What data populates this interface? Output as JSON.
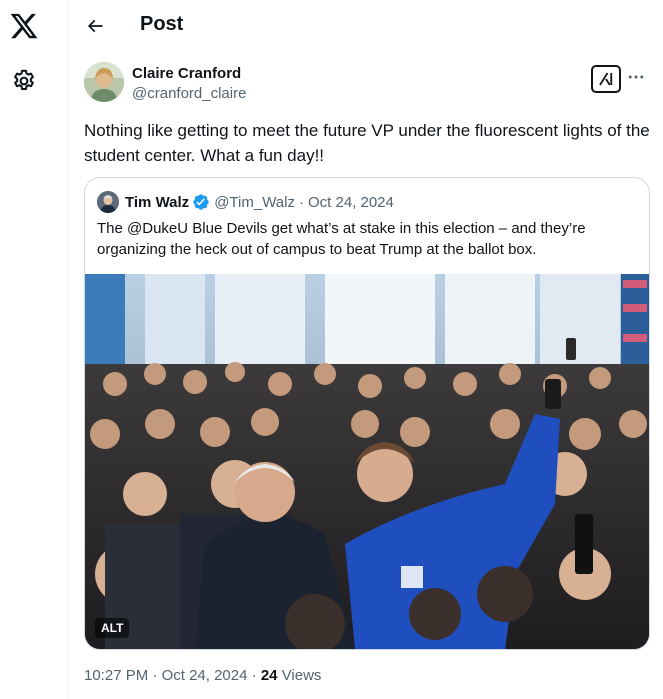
{
  "nav": {
    "logo_icon": "x-logo-icon",
    "settings_icon": "gear-icon"
  },
  "header": {
    "back_icon": "arrow-left-icon",
    "title": "Post"
  },
  "post": {
    "author_name": "Claire Cranford",
    "author_handle": "@cranford_claire",
    "text": "Nothing like getting to meet the future VP under the fluorescent lights of the student center. What a fun day!!",
    "time": "10:27 PM",
    "date": "Oct 24, 2024",
    "separator": "·",
    "views_count": "24",
    "views_label": "Views"
  },
  "quote": {
    "author_name": "Tim Walz",
    "author_handle": "@Tim_Walz",
    "separator": "·",
    "date": "Oct 24, 2024",
    "verified": true,
    "text": "The @DukeU Blue Devils get what’s at stake in this election – and they’re organizing the heck out of campus to beat Trump at the ballot box.",
    "image_alt_badge": "ALT"
  },
  "colors": {
    "text_primary": "#0f1419",
    "text_secondary": "#536471",
    "border": "#cfd9de",
    "verified_blue": "#1d9bf0",
    "duke_blue": "#1f4fbf"
  }
}
